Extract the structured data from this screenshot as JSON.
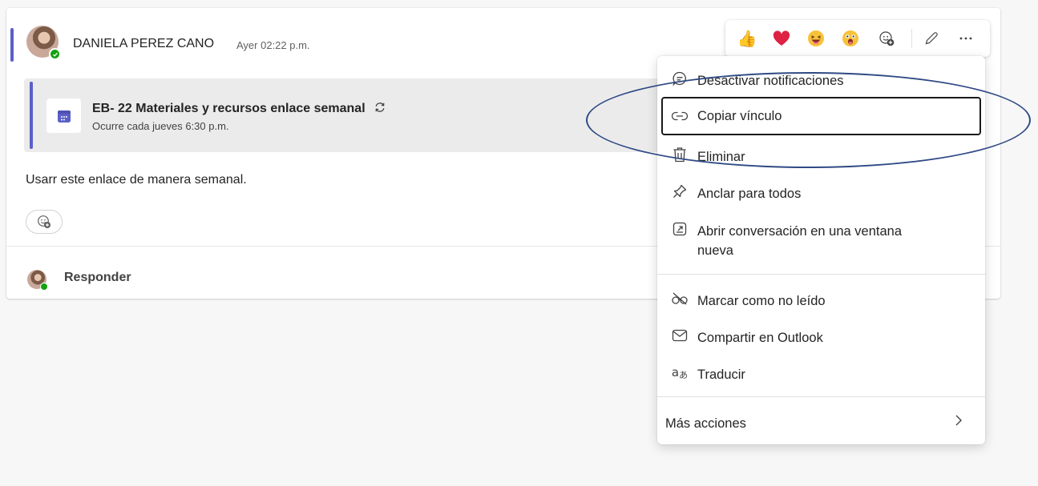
{
  "post": {
    "author": "DANIELA PEREZ CANO",
    "timestamp": "Ayer 02:22 p.m.",
    "meeting": {
      "title": "EB- 22 Materiales y recursos enlace semanal",
      "recurrence": "Ocurre cada jueves 6:30 p.m.",
      "icon": "calendar-icon"
    },
    "body": "Usarr este enlace de manera semanal.",
    "reply_label": "Responder"
  },
  "reactions": [
    {
      "name": "like",
      "glyph": "👍"
    },
    {
      "name": "heart",
      "glyph": "❤"
    },
    {
      "name": "laugh",
      "glyph": "😆"
    },
    {
      "name": "surprised",
      "glyph": "😮"
    }
  ],
  "menu": {
    "items": [
      {
        "label": "Desactivar notificaciones",
        "icon": "chat-off-icon"
      },
      {
        "label": "Copiar vínculo",
        "icon": "link-icon"
      },
      {
        "label": "Eliminar",
        "icon": "trash-icon"
      },
      {
        "label": "Anclar para todos",
        "icon": "pin-icon"
      },
      {
        "label": "Abrir conversación en una ventana",
        "label2": "nueva",
        "icon": "open-window-icon"
      },
      {
        "label": "Marcar como no leído",
        "icon": "unread-icon"
      },
      {
        "label": "Compartir en Outlook",
        "icon": "mail-icon"
      },
      {
        "label": "Traducir",
        "icon": "translate-icon"
      },
      {
        "label": "Más acciones",
        "icon": "chevron-right-icon"
      }
    ]
  },
  "colors": {
    "accent": "#5b5fc7",
    "presence": "#13a10e",
    "annotation": "#2f4a84"
  }
}
